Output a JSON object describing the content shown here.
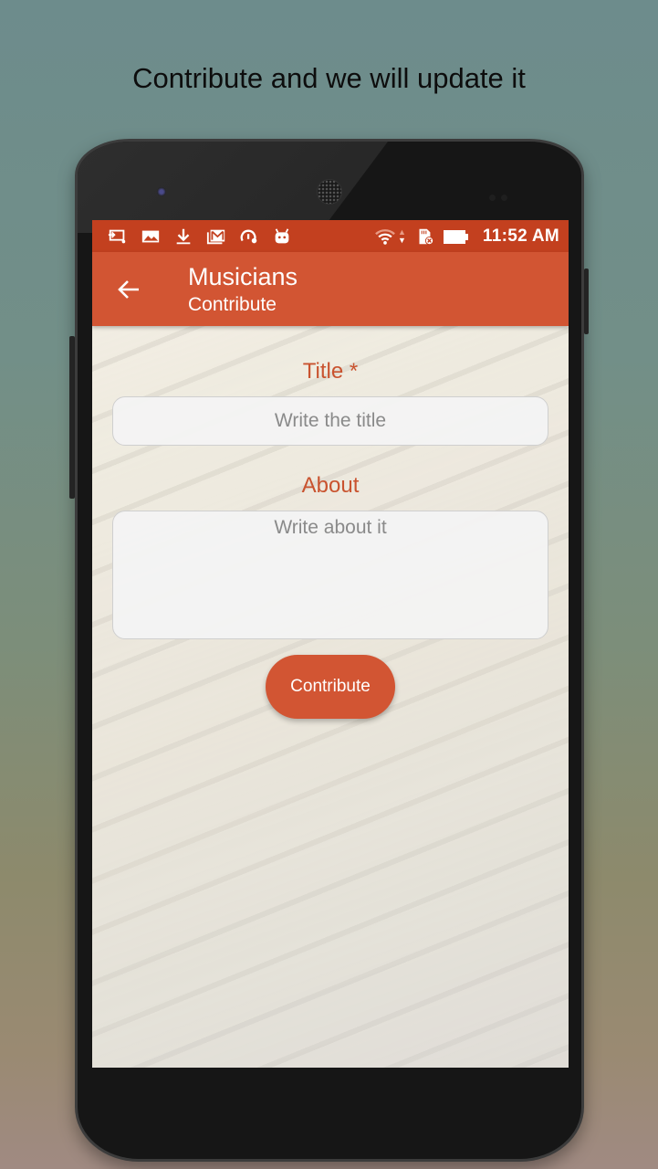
{
  "promo": {
    "caption": "Contribute and we will update it"
  },
  "status_bar": {
    "left_icons": [
      "screen-cast-icon",
      "image-icon",
      "download-icon",
      "gmail-icon",
      "speedometer-icon",
      "android-icon"
    ],
    "right_icons": [
      "wifi-icon",
      "data-arrows-icon",
      "sd-card-error-icon",
      "battery-icon"
    ],
    "time": "11:52 AM"
  },
  "app_bar": {
    "title": "Musicians",
    "subtitle": "Contribute",
    "back_icon": "arrow-left-icon"
  },
  "form": {
    "title_label": "Title *",
    "title_placeholder": "Write the title",
    "about_label": "About",
    "about_placeholder": "Write about it",
    "submit_label": "Contribute"
  },
  "colors": {
    "primary": "#d25533",
    "status_bar": "#c3401f",
    "label": "#c9532f"
  }
}
